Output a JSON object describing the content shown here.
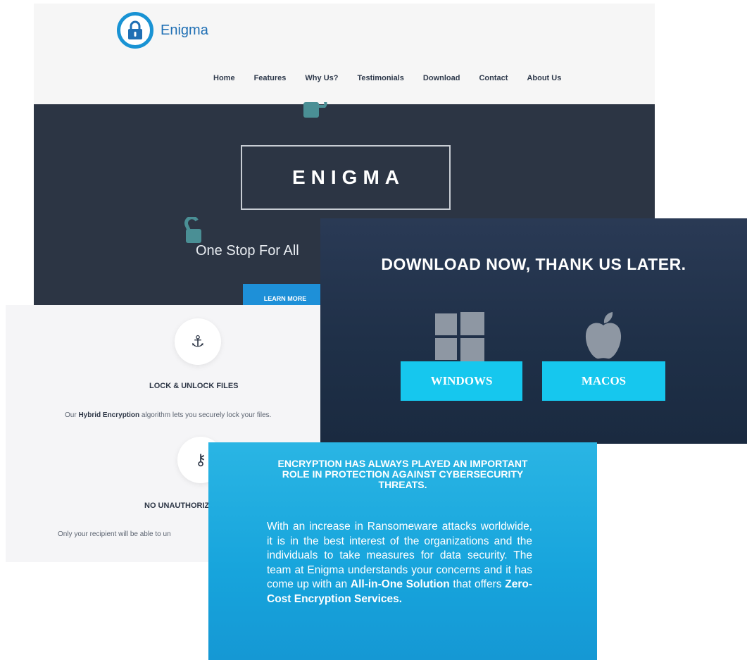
{
  "site": {
    "brand": "Enigma",
    "nav": [
      "Home",
      "Features",
      "Why Us?",
      "Testimonials",
      "Download",
      "Contact",
      "About Us"
    ],
    "hero_title": "ENIGMA",
    "tagline": "One Stop For All",
    "learn_more": "LEARN MORE"
  },
  "features": [
    {
      "icon": "anchor-icon",
      "title": "LOCK & UNLOCK FILES",
      "desc_before": "Our ",
      "desc_bold": "Hybrid Encryption",
      "desc_after": " algorithm lets you securely lock your files."
    },
    {
      "icon": "key-icon",
      "title": "NO UNAUTHORIZ",
      "desc": "Only your recipient will be able to un"
    }
  ],
  "download": {
    "title": "DOWNLOAD NOW, THANK US LATER.",
    "windows_label": "WINDOWS",
    "macos_label": "MACOS"
  },
  "about": {
    "heading": [
      "ENCRYPTION HAS ALWAYS PLAYED AN IMPORTANT",
      "ROLE IN PROTECTION AGAINST CYBERSECURITY",
      "THREATS."
    ],
    "body_intro": "With an increase in Ransomeware attacks worldwide, it is in the best interest of the organizations and the individuals to take measures for data security. The team at Enigma understands your concerns and it has come up with an ",
    "bold_solution": "All-in-One Solution",
    "body_middle": " that offers ",
    "bold_services": "Zero-Cost Encryption Services."
  },
  "colors": {
    "hero_bg": "#2c3544",
    "accent_blue": "#1e90d8",
    "download_button": "#16c7ee",
    "about_bg": "#17a4dc"
  }
}
